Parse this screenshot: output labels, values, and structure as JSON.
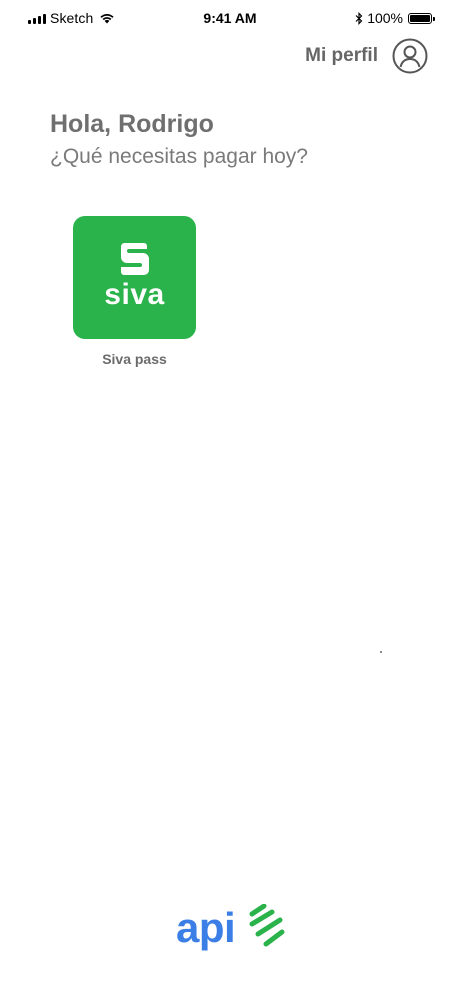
{
  "status_bar": {
    "carrier": "Sketch",
    "time": "9:41 AM",
    "battery": "100%"
  },
  "header": {
    "profile_label": "Mi perfil"
  },
  "greeting": {
    "title": "Hola, Rodrigo",
    "subtitle": "¿Qué necesitas pagar hoy?"
  },
  "services": [
    {
      "logo_text": "siva",
      "label": "Siva pass"
    }
  ],
  "brand": {
    "logo_text": "api"
  },
  "colors": {
    "siva_green": "#2ab24b",
    "api_blue": "#3b7fe6",
    "api_green": "#2ab24b",
    "text_gray": "#6f6f6f"
  },
  "icons": {
    "profile": "user-circle-icon",
    "wifi": "wifi-icon",
    "bluetooth": "bluetooth-icon",
    "battery": "battery-icon"
  }
}
